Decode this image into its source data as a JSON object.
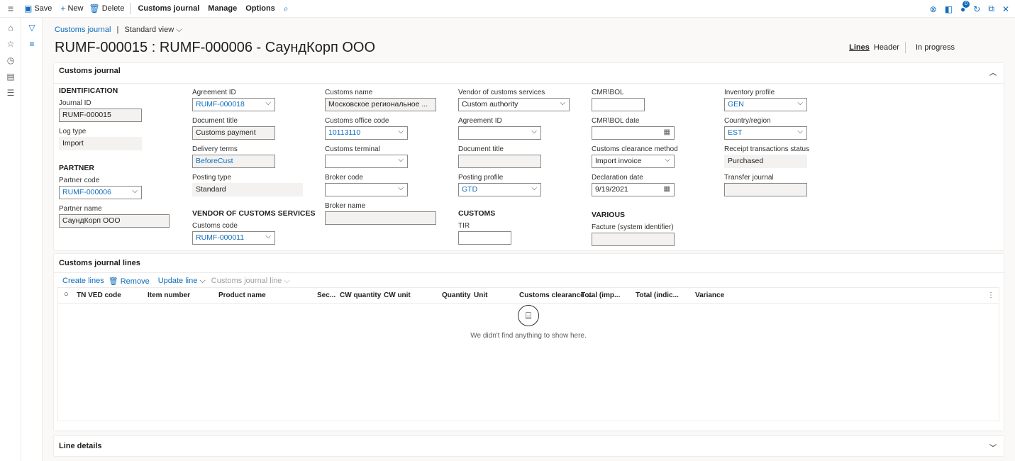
{
  "toolbar": {
    "save": "Save",
    "new": "New",
    "delete": "Delete",
    "menus": [
      "Customs journal",
      "Manage",
      "Options"
    ],
    "right_badge_count": "0"
  },
  "breadcrumb": {
    "link": "Customs journal",
    "sep": "|",
    "view": "Standard view"
  },
  "title": "RUMF-000015 : RUMF-000006 - СаундКорп ООО",
  "view_tabs": {
    "lines": "Lines",
    "header": "Header",
    "status": "In progress"
  },
  "customs_journal_section": {
    "title": "Customs journal",
    "identification": {
      "title": "IDENTIFICATION",
      "journal_id_label": "Journal ID",
      "journal_id": "RUMF-000015",
      "log_type_label": "Log type",
      "log_type": "Import"
    },
    "partner": {
      "title": "PARTNER",
      "partner_code_label": "Partner code",
      "partner_code": "RUMF-000006",
      "partner_name_label": "Partner name",
      "partner_name": "СаундКорп ООО"
    },
    "col2": {
      "agreement_id_label": "Agreement ID",
      "agreement_id": "RUMF-000018",
      "document_title_label": "Document title",
      "document_title": "Customs payment",
      "delivery_terms_label": "Delivery terms",
      "delivery_terms": "BeforeCust",
      "posting_type_label": "Posting type",
      "posting_type": "Standard",
      "vendor_group_title": "VENDOR OF CUSTOMS SERVICES",
      "customs_code_label": "Customs code",
      "customs_code": "RUMF-000011"
    },
    "col3": {
      "customs_name_label": "Customs name",
      "customs_name": "Московское региональное ...",
      "customs_office_code_label": "Customs office code",
      "customs_office_code": "10113110",
      "customs_terminal_label": "Customs terminal",
      "customs_terminal": "",
      "broker_code_label": "Broker code",
      "broker_code": "",
      "broker_name_label": "Broker name",
      "broker_name": ""
    },
    "col4": {
      "vendor_label": "Vendor of customs services",
      "vendor": "Custom authority",
      "agreement_id_label": "Agreement ID",
      "agreement_id": "",
      "document_title_label": "Document title",
      "document_title": "",
      "posting_profile_label": "Posting profile",
      "posting_profile": "GTD",
      "customs_group_title": "CUSTOMS",
      "tir_label": "TIR",
      "tir": ""
    },
    "col5": {
      "cmr_label": "CMR\\BOL",
      "cmr": "",
      "cmr_date_label": "CMR\\BOL date",
      "cmr_date": "",
      "clearance_method_label": "Customs clearance method",
      "clearance_method": "Import invoice",
      "declaration_date_label": "Declaration date",
      "declaration_date": "9/19/2021",
      "various_group_title": "VARIOUS",
      "facture_label": "Facture (system identifier)",
      "facture": ""
    },
    "col6": {
      "inventory_profile_label": "Inventory profile",
      "inventory_profile": "GEN",
      "country_label": "Country/region",
      "country": "EST",
      "receipt_status_label": "Receipt transactions status",
      "receipt_status": "Purchased",
      "transfer_journal_label": "Transfer journal",
      "transfer_journal": ""
    }
  },
  "lines_section": {
    "title": "Customs journal lines",
    "actions": {
      "create": "Create lines",
      "remove": "Remove",
      "update": "Update line",
      "lines_menu": "Customs journal line"
    },
    "columns": [
      "TN VED code",
      "Item number",
      "Product name",
      "Sec...",
      "CW quantity",
      "CW unit",
      "Quantity",
      "Unit",
      "Customs clearance ...",
      "Total (imp...",
      "Total (indic...",
      "Variance"
    ],
    "empty_text": "We didn't find anything to show here."
  },
  "line_details": {
    "title": "Line details"
  }
}
